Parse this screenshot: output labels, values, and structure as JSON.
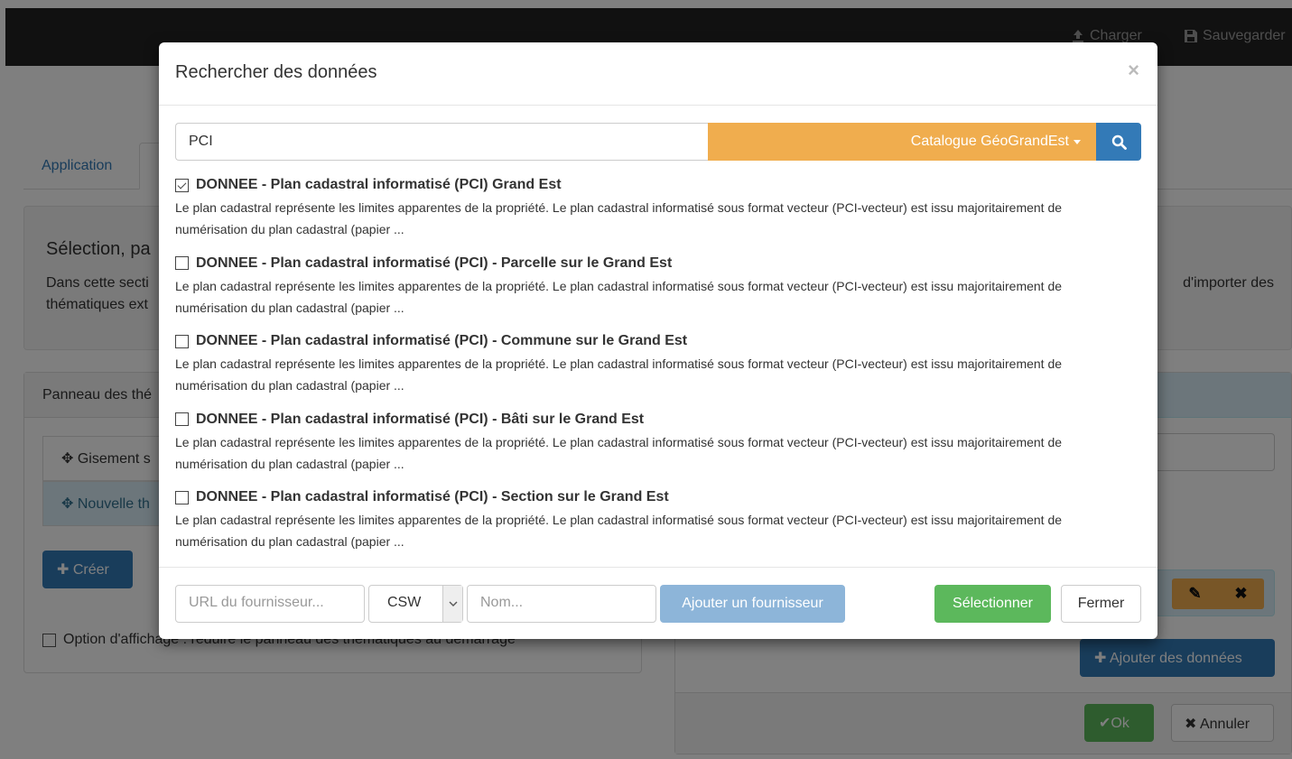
{
  "navbar": {
    "load_label": "Charger",
    "save_label": "Sauvegarder"
  },
  "tabs": [
    {
      "label": "Application"
    }
  ],
  "well": {
    "title": "Sélection, pa",
    "text_left": "Dans cette secti",
    "text_left2": "thématiques ext",
    "text_right": "d'importer des"
  },
  "left_panel": {
    "heading": "Panneau des thé",
    "items": [
      {
        "label": "Gisement s"
      },
      {
        "label": "Nouvelle th"
      }
    ],
    "create_label": "Créer",
    "option_label": "Option d'affichage : réduire le panneau des thématiques au démarrage"
  },
  "right_panel": {
    "add_data_label": "Ajouter des données",
    "ok_label": "Ok",
    "cancel_label": "Annuler"
  },
  "modal": {
    "title": "Rechercher des données",
    "close_symbol": "×",
    "search": {
      "value": "PCI",
      "catalog_label": "Catalogue GéoGrandEst"
    },
    "results": [
      {
        "title": "DONNEE - Plan cadastral informatisé (PCI) Grand Est",
        "checked": true,
        "desc": "Le plan cadastral représente les limites apparentes de la propriété. Le plan cadastral informatisé sous format vecteur (PCI-vecteur) est issu majoritairement de numérisation du plan cadastral (papier ..."
      },
      {
        "title": "DONNEE - Plan cadastral informatisé (PCI) - Parcelle sur le Grand Est",
        "checked": false,
        "desc": "Le plan cadastral représente les limites apparentes de la propriété. Le plan cadastral informatisé sous format vecteur (PCI-vecteur) est issu majoritairement de numérisation du plan cadastral (papier ..."
      },
      {
        "title": "DONNEE - Plan cadastral informatisé (PCI) - Commune sur le Grand Est",
        "checked": false,
        "desc": "Le plan cadastral représente les limites apparentes de la propriété. Le plan cadastral informatisé sous format vecteur (PCI-vecteur) est issu majoritairement de numérisation du plan cadastral (papier ..."
      },
      {
        "title": "DONNEE - Plan cadastral informatisé (PCI) - Bâti sur le Grand Est",
        "checked": false,
        "desc": "Le plan cadastral représente les limites apparentes de la propriété. Le plan cadastral informatisé sous format vecteur (PCI-vecteur) est issu majoritairement de numérisation du plan cadastral (papier ..."
      },
      {
        "title": "DONNEE - Plan cadastral informatisé (PCI) - Section sur le Grand Est",
        "checked": false,
        "desc": "Le plan cadastral représente les limites apparentes de la propriété. Le plan cadastral informatisé sous format vecteur (PCI-vecteur) est issu majoritairement de numérisation du plan cadastral (papier ..."
      }
    ],
    "footer": {
      "url_placeholder": "URL du fournisseur...",
      "type_value": "CSW",
      "name_placeholder": "Nom...",
      "add_provider_label": "Ajouter un fournisseur",
      "select_label": "Sélectionner",
      "close_label": "Fermer"
    }
  },
  "colors": {
    "primary": "#337ab7",
    "warning": "#f0ad4e",
    "success": "#5cb85c",
    "navbar": "#222222"
  }
}
